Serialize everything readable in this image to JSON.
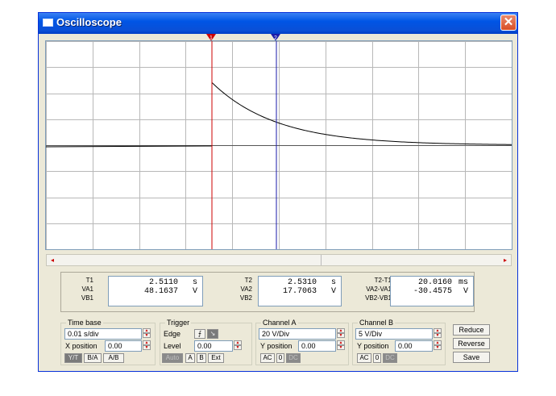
{
  "window": {
    "title": "Oscilloscope",
    "close_glyph": "✕"
  },
  "cursors": {
    "c1_label": "1",
    "c2_label": "2",
    "c1_color": "#cc0000",
    "c2_color": "#1a1aa8"
  },
  "scrollbar": {
    "left_arrow": "◂",
    "right_arrow": "▸"
  },
  "trace": {
    "color": "#000000",
    "baseline_level": 0,
    "step_peak": 48.1637,
    "cursor2_value": 17.7063,
    "description_unit": "V"
  },
  "readout": {
    "t1": {
      "labels": [
        "T1",
        "VA1",
        "VB1"
      ],
      "time": "2.5110",
      "time_unit": "s",
      "va": "48.1637",
      "va_unit": "V",
      "vb": ""
    },
    "t2": {
      "labels": [
        "T2",
        "VA2",
        "VB2"
      ],
      "time": "2.5310",
      "time_unit": "s",
      "va": "17.7063",
      "va_unit": "V",
      "vb": ""
    },
    "diff": {
      "labels": [
        "T2-T1",
        "VA2-VA1",
        "VB2-VB1"
      ],
      "time": "20.0160",
      "time_unit": "ms",
      "va": "-30.4575",
      "va_unit": "V",
      "vb": ""
    }
  },
  "timebase": {
    "title": "Time base",
    "value": "0.01 s/div",
    "xpos_label": "X position",
    "xpos_value": "0.00",
    "buttons": [
      "Y/T",
      "B/A",
      "A/B"
    ]
  },
  "trigger": {
    "title": "Trigger",
    "edge_label": "Edge",
    "level_label": "Level",
    "level_value": "0.00",
    "buttons": [
      "Auto",
      "A",
      "B",
      "Ext"
    ]
  },
  "channel_a": {
    "title": "Channel A",
    "value": "20 V/Div",
    "ypos_label": "Y position",
    "ypos_value": "0.00",
    "buttons": [
      "AC",
      "0",
      "DC"
    ]
  },
  "channel_b": {
    "title": "Channel B",
    "value": "5 V/Div",
    "ypos_label": "Y position",
    "ypos_value": "0.00",
    "buttons": [
      "AC",
      "0",
      "DC"
    ]
  },
  "side_buttons": {
    "reduce": "Reduce",
    "reverse": "Reverse",
    "save": "Save"
  }
}
